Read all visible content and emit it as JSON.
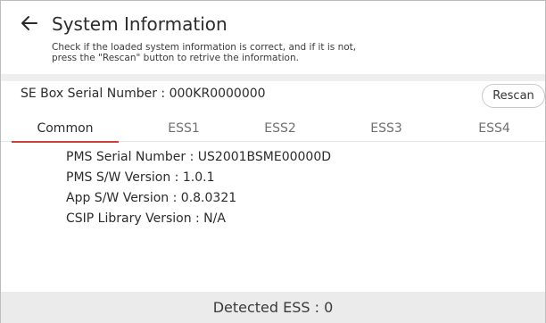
{
  "header": {
    "title": "System Information",
    "description_line1": "Check if the loaded system information is correct, and if it is not,",
    "description_line2": "press the \"Rescan\" button to retrive the information."
  },
  "serial": {
    "text": "SE Box Serial Number : 000KR0000000",
    "rescan_label": "Rescan"
  },
  "tabs": [
    {
      "label": "Common",
      "active": true
    },
    {
      "label": "ESS1",
      "active": false
    },
    {
      "label": "ESS2",
      "active": false
    },
    {
      "label": "ESS3",
      "active": false
    },
    {
      "label": "ESS4",
      "active": false
    }
  ],
  "info": [
    "PMS Serial Number : US2001BSME00000D",
    "PMS S/W Version : 1.0.1",
    "App S/W Version : 0.8.0321",
    "CSIP Library Version : N/A"
  ],
  "footer": {
    "detected": "Detected ESS : 0"
  },
  "colors": {
    "accent": "#c9413e",
    "band": "#eeeeee",
    "footer_bg": "#ebebeb"
  },
  "icons": {
    "back": "arrow-left-icon"
  }
}
